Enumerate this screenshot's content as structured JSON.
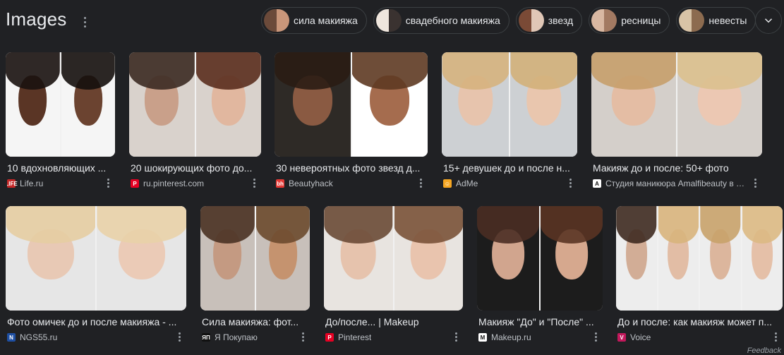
{
  "header": {
    "title": "Images"
  },
  "chips": [
    {
      "label": "сила макияжа",
      "colors": [
        "#6b4a3a",
        "#c9967a"
      ]
    },
    {
      "label": "свадебного макияжа",
      "colors": [
        "#efe6dd",
        "#3a3230"
      ]
    },
    {
      "label": "звезд",
      "colors": [
        "#7a4a36",
        "#e0c7b6"
      ]
    },
    {
      "label": "ресницы",
      "colors": [
        "#d9b8a2",
        "#a37a62"
      ]
    },
    {
      "label": "невесты",
      "colors": [
        "#d8c3a6",
        "#8c6b4f"
      ]
    }
  ],
  "results": [
    {
      "caption": "10 вдохновляющих ...",
      "source": "Life.ru",
      "fav_text": "LIFE",
      "fav_color": "#c62828",
      "halves": [
        {
          "skin": "#5a3525",
          "hair": "#1a1210",
          "bg": "#f5f5f5"
        },
        {
          "skin": "#6b4330",
          "hair": "#15100d",
          "bg": "#f5f5f5"
        }
      ]
    },
    {
      "caption": "20 шокирующих фото до...",
      "source": "ru.pinterest.com",
      "fav_text": "P",
      "fav_color": "#e60023",
      "halves": [
        {
          "skin": "#c9a08a",
          "hair": "#3b2a22",
          "bg": "#d9d2cc"
        },
        {
          "skin": "#e1b79f",
          "hair": "#5a2e1e",
          "bg": "#d9d2cc"
        }
      ]
    },
    {
      "caption": "30 невероятных фото звезд д...",
      "source": "Beautyhack",
      "fav_text": "bh",
      "fav_color": "#e53935",
      "halves": [
        {
          "skin": "#8a5a42",
          "hair": "#2a1c14",
          "bg": "#2e2a26"
        },
        {
          "skin": "#a56c4e",
          "hair": "#5e3a22",
          "bg": "#ffffff"
        }
      ]
    },
    {
      "caption": "15+ девушек до и после н...",
      "source": "AdMe",
      "fav_text": "☺",
      "fav_color": "#f5a623",
      "halves": [
        {
          "skin": "#e7c4ad",
          "hair": "#d6b27e",
          "bg": "#cdd0d3"
        },
        {
          "skin": "#e9c6ae",
          "hair": "#d3b07a",
          "bg": "#cdd0d3"
        }
      ]
    },
    {
      "caption": "Макияж до и после: 50+ фото",
      "source": "Студия маникюра Amalfibeauty в Мос...",
      "fav_text": "A",
      "fav_color": "#ffffff",
      "halves": [
        {
          "skin": "#e4bda4",
          "hair": "#c79e6b",
          "bg": "#d4cfca"
        },
        {
          "skin": "#ecc8b3",
          "hair": "#dcc08e",
          "bg": "#d4cfca"
        }
      ]
    },
    {
      "caption": "Фото омичек до и после макияжа - ...",
      "source": "NGS55.ru",
      "fav_text": "N",
      "fav_color": "#1e4fa3",
      "halves": [
        {
          "skin": "#e8c9b5",
          "hair": "#e5cda2",
          "bg": "#e6e6e6"
        },
        {
          "skin": "#ebcbb7",
          "hair": "#e9d2a8",
          "bg": "#e6e6e6"
        }
      ]
    },
    {
      "caption": "Сила макияжа: фот...",
      "source": "Я Покупаю",
      "fav_text": "ЯП",
      "fav_color": "#111111",
      "halves": [
        {
          "skin": "#c49a82",
          "hair": "#4a3224",
          "bg": "#c8c0ba"
        },
        {
          "skin": "#c5936f",
          "hair": "#6b4a2e",
          "bg": "#c8c0ba"
        }
      ]
    },
    {
      "caption": "До/после... | Makeup",
      "source": "Pinterest",
      "fav_text": "P",
      "fav_color": "#e60023",
      "halves": [
        {
          "skin": "#e6c3ad",
          "hair": "#6a4a36",
          "bg": "#e8e4e0"
        },
        {
          "skin": "#e9c4ae",
          "hair": "#7a5238",
          "bg": "#e8e4e0"
        }
      ]
    },
    {
      "caption": "Макияж \"До\" и \"После\" ...",
      "source": "Makeup.ru",
      "fav_text": "M",
      "fav_color": "#ffffff",
      "halves": [
        {
          "skin": "#d1a58e",
          "hair": "#4a2e24",
          "bg": "#1c1c1c"
        },
        {
          "skin": "#d6a88e",
          "hair": "#5a3424",
          "bg": "#1c1c1c"
        }
      ]
    },
    {
      "caption": "До и после: как макияж может п...",
      "source": "Voice",
      "fav_text": "V",
      "fav_color": "#c2185b",
      "halves": [
        {
          "skin": "#d2ad96",
          "hair": "#3e2a20",
          "bg": "#ededed"
        },
        {
          "skin": "#e2bda5",
          "hair": "#d8b47c",
          "bg": "#ededed"
        },
        {
          "skin": "#dcb69d",
          "hair": "#c8a26a",
          "bg": "#ededed"
        },
        {
          "skin": "#e5c0a8",
          "hair": "#dbb983",
          "bg": "#ededed"
        }
      ]
    }
  ],
  "footer": {
    "feedback": "Feedback"
  }
}
